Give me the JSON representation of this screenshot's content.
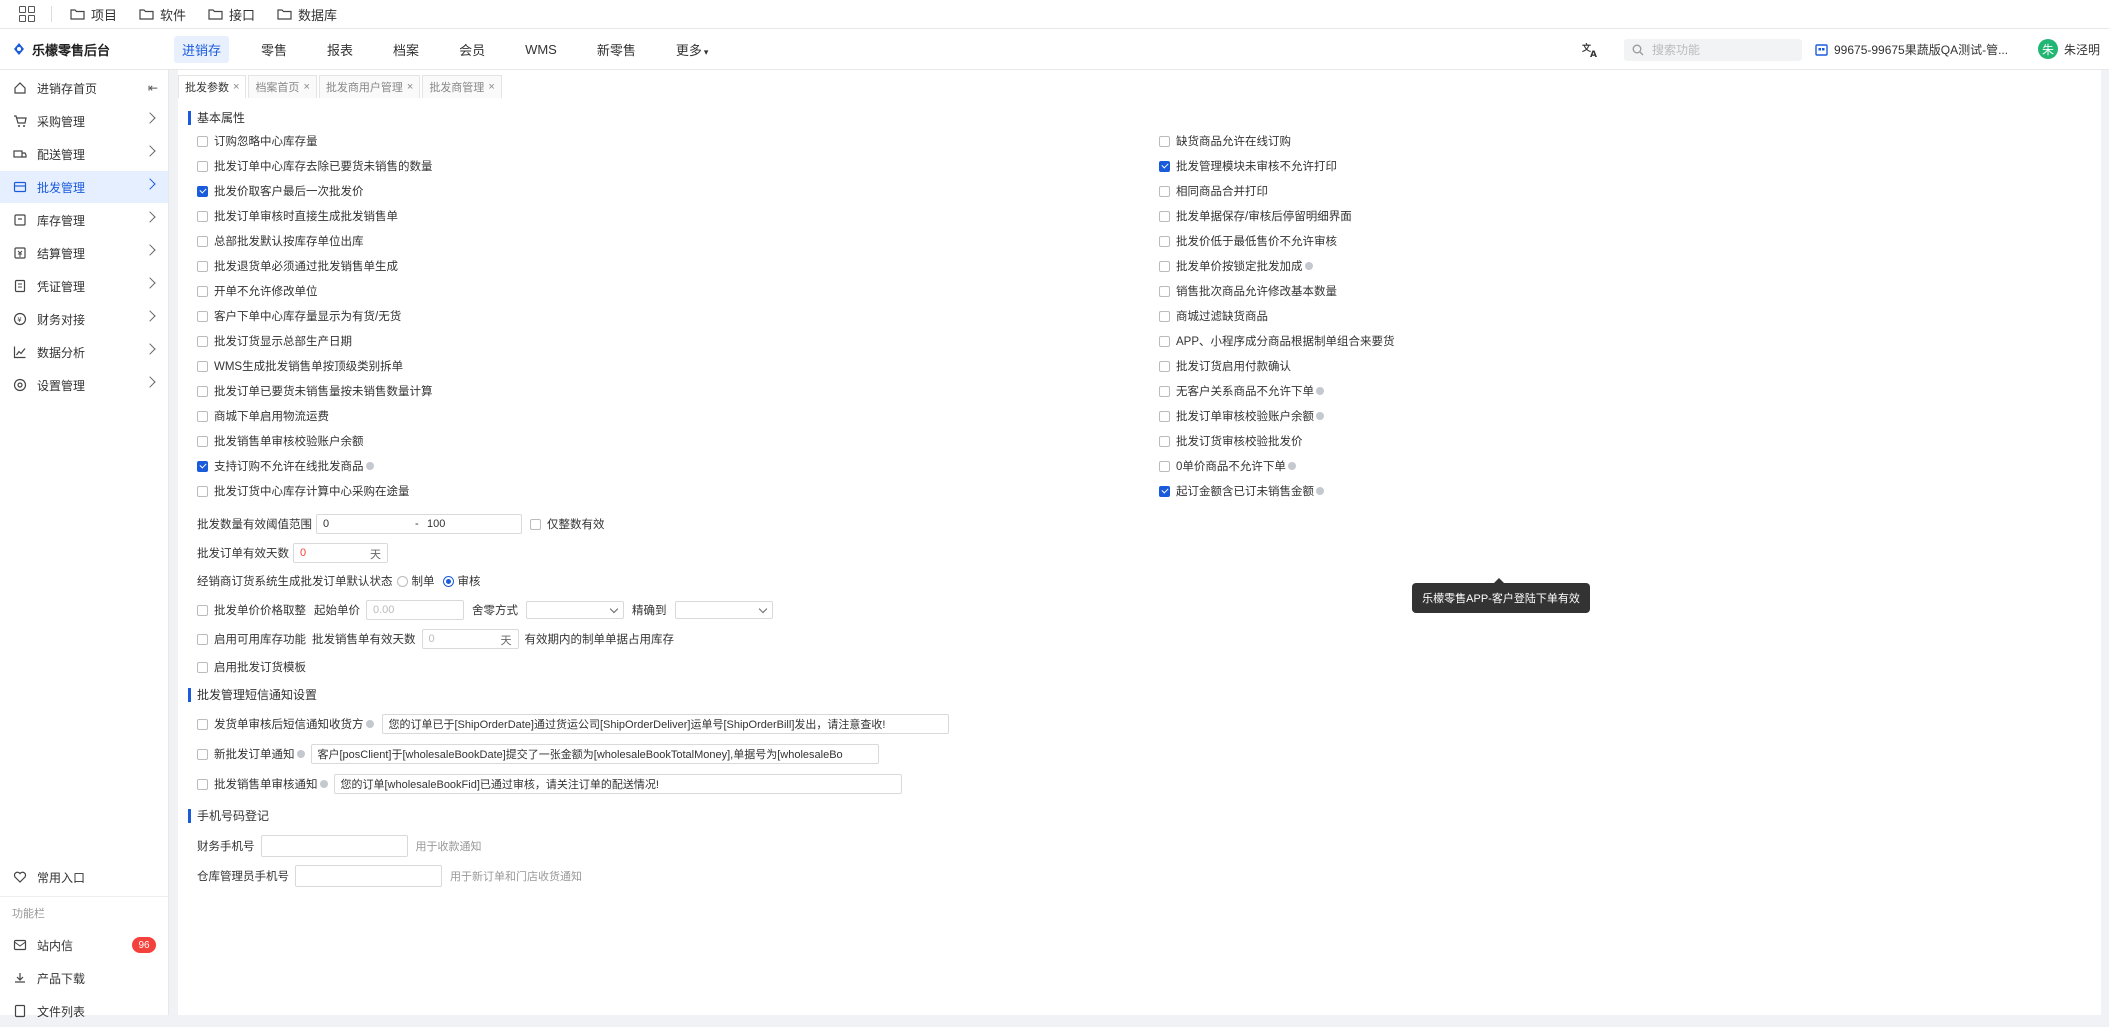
{
  "topbar": {
    "folders": [
      "项目",
      "软件",
      "接口",
      "数据库"
    ]
  },
  "header": {
    "logo": "乐檬零售后台",
    "nav": [
      "进销存",
      "零售",
      "报表",
      "档案",
      "会员",
      "WMS",
      "新零售",
      "更多"
    ],
    "search_placeholder": "搜索功能",
    "store": "99675-99675果蔬版QA测试-管...",
    "user_name": "朱泾明",
    "avatar_text": "朱",
    "accent": "#1a5bdb"
  },
  "sidebar": {
    "items": [
      {
        "label": "进销存首页",
        "icon": "home-icon"
      },
      {
        "label": "采购管理",
        "icon": "cart-icon"
      },
      {
        "label": "配送管理",
        "icon": "truck-icon"
      },
      {
        "label": "批发管理",
        "icon": "wholesale-icon"
      },
      {
        "label": "库存管理",
        "icon": "box-icon"
      },
      {
        "label": "结算管理",
        "icon": "settle-icon"
      },
      {
        "label": "凭证管理",
        "icon": "voucher-icon"
      },
      {
        "label": "财务对接",
        "icon": "finance-icon"
      },
      {
        "label": "数据分析",
        "icon": "chart-icon"
      },
      {
        "label": "设置管理",
        "icon": "settings-icon"
      }
    ],
    "favorites": "常用入口",
    "caption": "功能栏",
    "messages": "站内信",
    "messages_badge": "96",
    "downloads": "产品下载",
    "files": "文件列表"
  },
  "tabs": [
    "批发参数",
    "档案首页",
    "批发商用户管理",
    "批发商管理"
  ],
  "sections": {
    "basic": "基本属性",
    "sms": "批发管理短信通知设置",
    "phone": "手机号码登记"
  },
  "left_options": [
    {
      "label": "订购忽略中心库存量",
      "checked": false
    },
    {
      "label": "批发订单中心库存去除已要货未销售的数量",
      "checked": false
    },
    {
      "label": "批发价取客户最后一次批发价",
      "checked": true
    },
    {
      "label": "批发订单审核时直接生成批发销售单",
      "checked": false
    },
    {
      "label": "总部批发默认按库存单位出库",
      "checked": false
    },
    {
      "label": "批发退货单必须通过批发销售单生成",
      "checked": false
    },
    {
      "label": "开单不允许修改单位",
      "checked": false
    },
    {
      "label": "客户下单中心库存量显示为有货/无货",
      "checked": false
    },
    {
      "label": "批发订货显示总部生产日期",
      "checked": false
    },
    {
      "label": "WMS生成批发销售单按顶级类别拆单",
      "checked": false
    },
    {
      "label": "批发订单已要货未销售量按未销售数量计算",
      "checked": false
    },
    {
      "label": "商城下单启用物流运费",
      "checked": false
    },
    {
      "label": "批发销售单审核校验账户余额",
      "checked": false
    },
    {
      "label": "支持订购不允许在线批发商品",
      "checked": true,
      "info": true
    },
    {
      "label": "批发订货中心库存计算中心采购在途量",
      "checked": false
    }
  ],
  "right_options": [
    {
      "label": "缺货商品允许在线订购",
      "checked": false
    },
    {
      "label": "批发管理模块未审核不允许打印",
      "checked": true
    },
    {
      "label": "相同商品合并打印",
      "checked": false
    },
    {
      "label": "批发单据保存/审核后停留明细界面",
      "checked": false
    },
    {
      "label": "批发价低于最低售价不允许审核",
      "checked": false
    },
    {
      "label": "批发单价按锁定批发加成",
      "checked": false,
      "info": true
    },
    {
      "label": "销售批次商品允许修改基本数量",
      "checked": false
    },
    {
      "label": "商城过滤缺货商品",
      "checked": false
    },
    {
      "label": "APP、小程序成分商品根据制单组合来要货",
      "checked": false
    },
    {
      "label": "批发订货启用付款确认",
      "checked": false
    },
    {
      "label": "无客户关系商品不允许下单",
      "checked": false,
      "info": true
    },
    {
      "label": "批发订单审核校验账户余额",
      "checked": false,
      "info": true
    },
    {
      "label": "批发订货审核校验批发价",
      "checked": false
    },
    {
      "label": "0单价商品不允许下单",
      "checked": false,
      "info": true
    },
    {
      "label": "起订金额含已订未销售金额",
      "checked": true,
      "info": true
    }
  ],
  "tooltip": "乐檬零售APP-客户登陆下单有效",
  "range": {
    "label": "批发数量有效阈值范围",
    "min": "0",
    "dash": "-",
    "max": "100",
    "only_int": "仅整数有效"
  },
  "valid_days": {
    "label": "批发订单有效天数",
    "value": "0",
    "unit": "天"
  },
  "default_state": {
    "label": "经销商订货系统生成批发订单默认状态",
    "opt1": "制单",
    "opt2": "审核",
    "selected": "审核"
  },
  "price_round": {
    "label": "批发单价价格取整",
    "start_label": "起始单价",
    "start_placeholder": "0.00",
    "mode_label": "舍零方式",
    "precision_label": "精确到"
  },
  "available_stock": {
    "label": "启用可用库存功能",
    "days_label": "批发销售单有效天数",
    "days_placeholder": "0",
    "unit": "天",
    "suffix": "有效期内的制单单据占用库存"
  },
  "order_template": "启用批发订货模板",
  "sms": [
    {
      "label": "发货单审核后短信通知收货方",
      "value": "您的订单已于[ShipOrderDate]通过货运公司[ShipOrderDeliver]运单号[ShipOrderBill]发出，请注意查收!"
    },
    {
      "label": "新批发订单通知",
      "value": "客户[posClient]于[wholesaleBookDate]提交了一张金额为[wholesaleBookTotalMoney],单据号为[wholesaleBo"
    },
    {
      "label": "批发销售单审核通知",
      "value": "您的订单[wholesaleBookFid]已通过审核，请关注订单的配送情况!"
    }
  ],
  "phone": {
    "finance_label": "财务手机号",
    "finance_hint": "用于收款通知",
    "warehouse_label": "仓库管理员手机号",
    "warehouse_hint": "用于新订单和门店收货通知"
  }
}
